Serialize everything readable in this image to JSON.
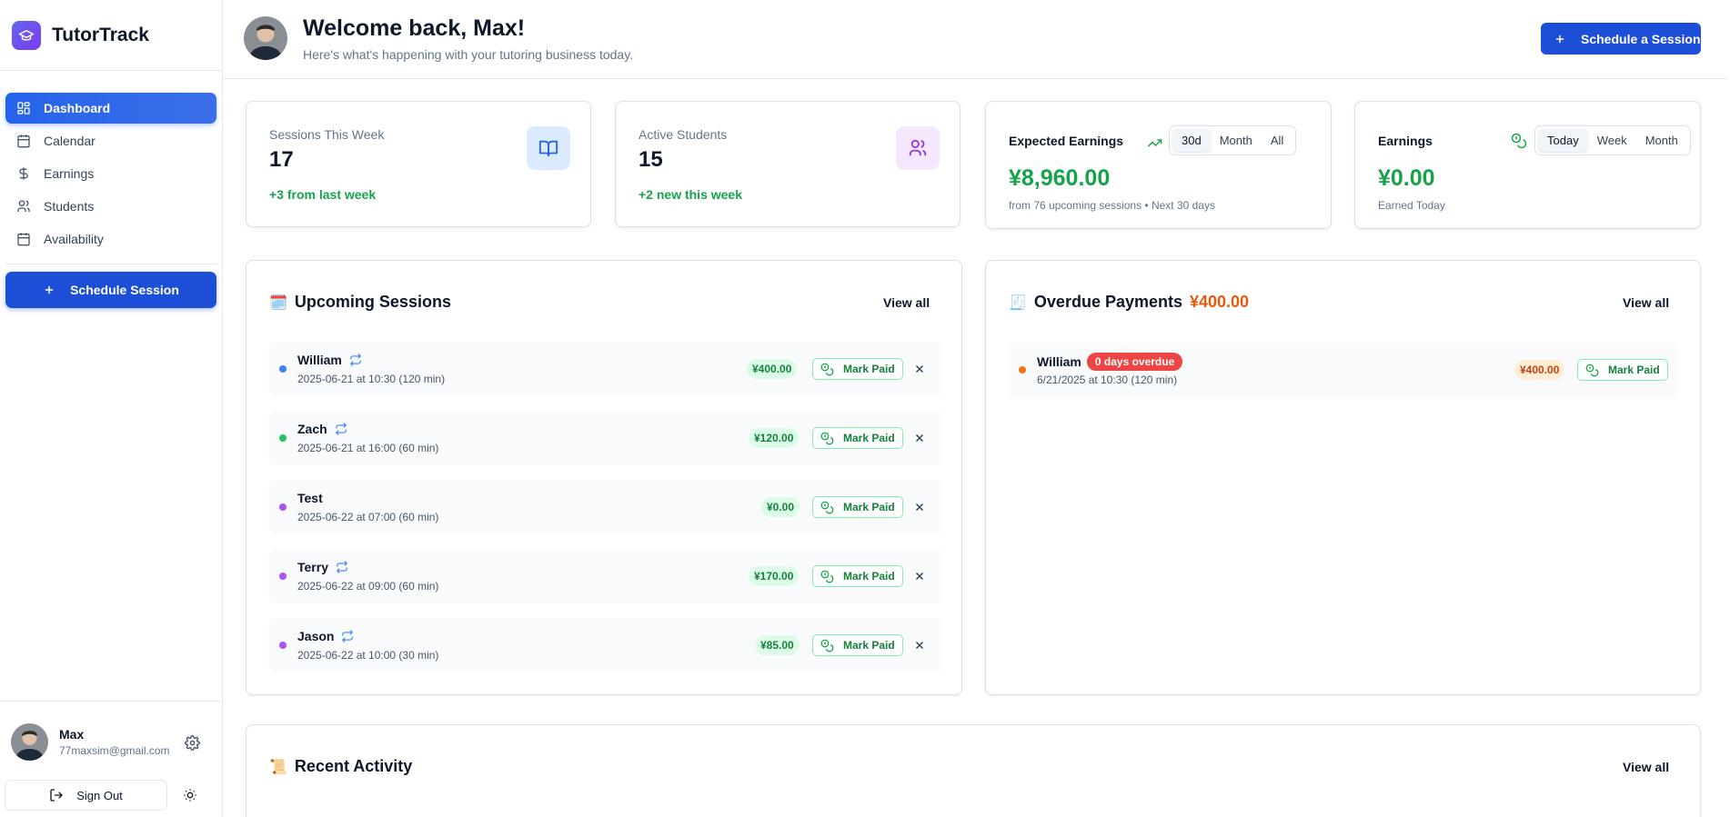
{
  "app": {
    "name": "TutorTrack"
  },
  "sidebar": {
    "items": [
      {
        "label": "Dashboard",
        "icon": "dashboard-icon",
        "active": true
      },
      {
        "label": "Calendar",
        "icon": "calendar-icon"
      },
      {
        "label": "Earnings",
        "icon": "dollar-icon"
      },
      {
        "label": "Students",
        "icon": "users-icon"
      },
      {
        "label": "Availability",
        "icon": "calendar-icon"
      }
    ],
    "cta_label": "Schedule Session",
    "user": {
      "name": "Max",
      "email": "77maxsim@gmail.com"
    },
    "sign_out_label": "Sign Out"
  },
  "header": {
    "welcome": "Welcome back, Max!",
    "subtitle": "Here's what's happening with your tutoring business today.",
    "cta_label": "Schedule a Session"
  },
  "stats": {
    "sessions": {
      "label": "Sessions This Week",
      "value": "17",
      "delta": "+3 from last week"
    },
    "students": {
      "label": "Active Students",
      "value": "15",
      "delta": "+2 new this week"
    },
    "expected": {
      "title": "Expected Earnings",
      "tabs": [
        "30d",
        "Month",
        "All"
      ],
      "selected": "30d",
      "value": "¥8,960.00",
      "sub": "from 76 upcoming sessions • Next 30 days"
    },
    "earnings": {
      "title": "Earnings",
      "tabs": [
        "Today",
        "Week",
        "Month"
      ],
      "selected": "Today",
      "value": "¥0.00",
      "sub": "Earned Today"
    }
  },
  "upcoming": {
    "title": "Upcoming Sessions",
    "emoji": "🗓️",
    "view_all": "View all",
    "mark_paid_label": "Mark Paid",
    "rows": [
      {
        "name": "William",
        "time": "2025-06-21 at 10:30 (120 min)",
        "amount": "¥400.00",
        "recurring": true,
        "dot_color": "#3b82f6"
      },
      {
        "name": "Zach",
        "time": "2025-06-21 at 16:00 (60 min)",
        "amount": "¥120.00",
        "recurring": true,
        "dot_color": "#22c55e"
      },
      {
        "name": "Test",
        "time": "2025-06-22 at 07:00 (60 min)",
        "amount": "¥0.00",
        "recurring": false,
        "dot_color": "#a855f7"
      },
      {
        "name": "Terry",
        "time": "2025-06-22 at 09:00 (60 min)",
        "amount": "¥170.00",
        "recurring": true,
        "dot_color": "#a855f7"
      },
      {
        "name": "Jason",
        "time": "2025-06-22 at 10:00 (30 min)",
        "amount": "¥85.00",
        "recurring": true,
        "dot_color": "#a855f7"
      }
    ]
  },
  "overdue": {
    "title": "Overdue Payments",
    "emoji": "🧾",
    "total": "¥400.00",
    "view_all": "View all",
    "mark_paid_label": "Mark Paid",
    "rows": [
      {
        "name": "William",
        "badge": "0 days overdue",
        "time": "6/21/2025 at 10:30 (120 min)",
        "amount": "¥400.00",
        "dot_color": "#f97316"
      }
    ]
  },
  "activity": {
    "title": "Recent Activity",
    "emoji": "📜",
    "view_all": "View all"
  },
  "colors": {
    "accent": "#1d4ed8",
    "success": "#16a34a",
    "warning": "#ea580c",
    "danger": "#ef4444"
  }
}
